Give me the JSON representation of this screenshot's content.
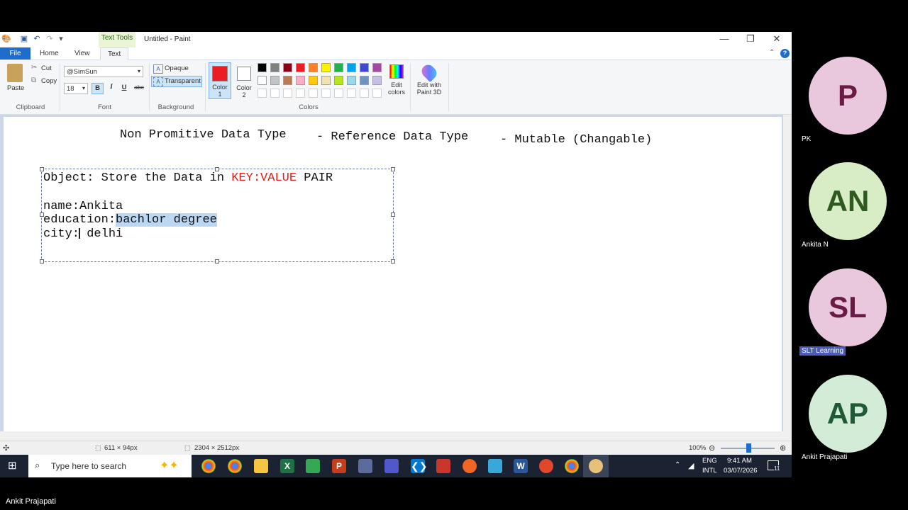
{
  "paint": {
    "context_tab": "Text Tools",
    "title": "Untitled - Paint",
    "tabs": [
      "File",
      "Home",
      "View",
      "Text"
    ],
    "clipboard": {
      "paste": "Paste",
      "cut": "Cut",
      "copy": "Copy",
      "group": "Clipboard"
    },
    "font": {
      "family": "@SimSun",
      "size": "18",
      "group": "Font",
      "bold": "B",
      "italic": "I",
      "underline": "U",
      "strike": "abc"
    },
    "background": {
      "opaque": "Opaque",
      "transparent": "Transparent",
      "group": "Background"
    },
    "colors": {
      "color1": "Color\n1",
      "color2": "Color\n2",
      "color1_l1": "Color",
      "color1_l2": "1",
      "color2_l1": "Color",
      "color2_l2": "2",
      "edit": "Edit colors",
      "edit_l1": "Edit",
      "edit_l2": "colors",
      "paint3d_l1": "Edit with",
      "paint3d_l2": "Paint 3D",
      "group": "Colors",
      "palette_row1": [
        "#000000",
        "#7f7f7f",
        "#880015",
        "#ed1c24",
        "#ff7f27",
        "#fff200",
        "#22b14c",
        "#00a2e8",
        "#3f48cc",
        "#a349a4"
      ],
      "palette_row2": [
        "#ffffff",
        "#c3c3c3",
        "#b97a57",
        "#ffaec9",
        "#ffc90e",
        "#efe4b0",
        "#b5e61d",
        "#99d9ea",
        "#7092be",
        "#c8bfe7"
      ],
      "primary": "#ed1c24",
      "secondary": "#ffffff"
    },
    "canvas": {
      "heading_1": "Non Promitive Data Type",
      "heading_2": "- Reference Data Type",
      "heading_3": "- Mutable (Changable)",
      "object_prefix": "Object: Store the Data in ",
      "object_key": "KEY:VALUE",
      "object_suffix": " PAIR",
      "line_name": "name:Ankita",
      "line_edu_key": "education:",
      "line_edu_val": "bachlor degree",
      "line_city_key": "city:",
      "line_city_val": " delhi"
    },
    "status": {
      "selection": "611 × 94px",
      "size": "2304 × 2512px",
      "zoom": "100%"
    }
  },
  "taskbar": {
    "search_placeholder": "Type here to search",
    "lang1": "ENG",
    "lang2": "INTL",
    "time": "9:41 AM",
    "date": "03/07/2026",
    "notif": "11"
  },
  "participants": [
    {
      "initials": "P",
      "name": "PK",
      "bg": "#e9c8dd",
      "fg": "#6a1a44"
    },
    {
      "initials": "AN",
      "name": "Ankita N",
      "bg": "#d8ecc6",
      "fg": "#2f5a1f"
    },
    {
      "initials": "SL",
      "name": "SLT Learning",
      "bg": "#e9c8dd",
      "fg": "#6a1a44"
    },
    {
      "initials": "AP",
      "name": "Ankit Prajapati",
      "bg": "#d3ecd8",
      "fg": "#1e5a35"
    }
  ],
  "presenter": "Ankit Prajapati"
}
